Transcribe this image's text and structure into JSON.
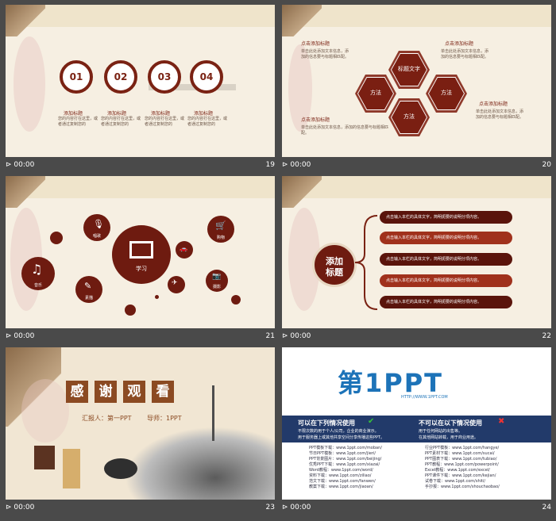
{
  "footer_time": "00:00",
  "slide19": {
    "number": "19",
    "steps": [
      {
        "num": "01",
        "title": "添加标题",
        "desc": "您的内容打在这里，或者通过复制您的"
      },
      {
        "num": "02",
        "title": "添加标题",
        "desc": "您的内容打在这里，或者通过复制您的"
      },
      {
        "num": "03",
        "title": "添加标题",
        "desc": "您的内容打在这里，或者通过复制您的"
      },
      {
        "num": "04",
        "title": "添加标题",
        "desc": "您的内容打在这里，或者通过复制您的"
      }
    ]
  },
  "slide20": {
    "number": "20",
    "title_tl": "点击添加标题",
    "title_tr": "点击添加标题",
    "title_bl": "点击添加标题",
    "title_br": "点击添加标题",
    "hex_labels": [
      "标题文字",
      "方法",
      "方法",
      "方法"
    ],
    "body": "单击此处添加文本信息，添加的信息要与标题相匹配。"
  },
  "slide21": {
    "number": "21",
    "center": "学习",
    "items": [
      "唱歌",
      "购物",
      "音乐",
      "素描",
      "旅行",
      "摄影"
    ]
  },
  "slide22": {
    "number": "22",
    "center_l1": "添加",
    "center_l2": "标题",
    "rows": [
      "点击输入本栏的具体文字，简明扼要的说明分项内容。",
      "点击输入本栏的具体文字，简明扼要的说明分项内容。",
      "点击输入本栏的具体文字，简明扼要的说明分项内容。",
      "点击输入本栏的具体文字，简明扼要的说明分项内容。",
      "点击输入本栏的具体文字，简明扼要的说明分项内容。"
    ]
  },
  "slide23": {
    "number": "23",
    "thanks": [
      "感",
      "谢",
      "观",
      "看"
    ],
    "reporter": "汇报人：第一PPT",
    "mentor": "导师：1PPT"
  },
  "slide24": {
    "number": "24",
    "logo_main": "第1PPT",
    "logo_url": "HTTP://WWW.1PPT.COM",
    "can_use": "可以在下列情况使用",
    "cannot_use": "不可以在以下情况使用",
    "left_notes": [
      "不限次数的用于个人/公司，企业的商业演示。",
      "用于服务器上或其他共享空间分享传播这些PPT。"
    ],
    "right_notes": [
      "用于任何网站的出售等。",
      "在其他网站转载，用于商业用途。"
    ],
    "left_links": [
      "PPT模板下载：www.1ppt.com/moban/",
      "节日PPT模板：www.1ppt.com/jieri/",
      "PPT背景图片：www.1ppt.com/beijing/",
      "优秀PPT下载：www.1ppt.com/xiazai/",
      "Word教程：www.1ppt.com/word/",
      "资料下载：www.1ppt.com/ziliao/",
      "范文下载：www.1ppt.com/fanwen/",
      "教案下载：www.1ppt.com/jiaoan/"
    ],
    "right_links": [
      "行业PPT模板：www.1ppt.com/hangye/",
      "PPT素材下载：www.1ppt.com/sucai/",
      "PPT图表下载：www.1ppt.com/tubiao/",
      "PPT教程：www.1ppt.com/powerpoint/",
      "Excel教程：www.1ppt.com/excel/",
      "PPT课件下载：www.1ppt.com/kejian/",
      "试卷下载：www.1ppt.com/shiti/",
      "手抄报：www.1ppt.com/shouchaobao/"
    ]
  }
}
